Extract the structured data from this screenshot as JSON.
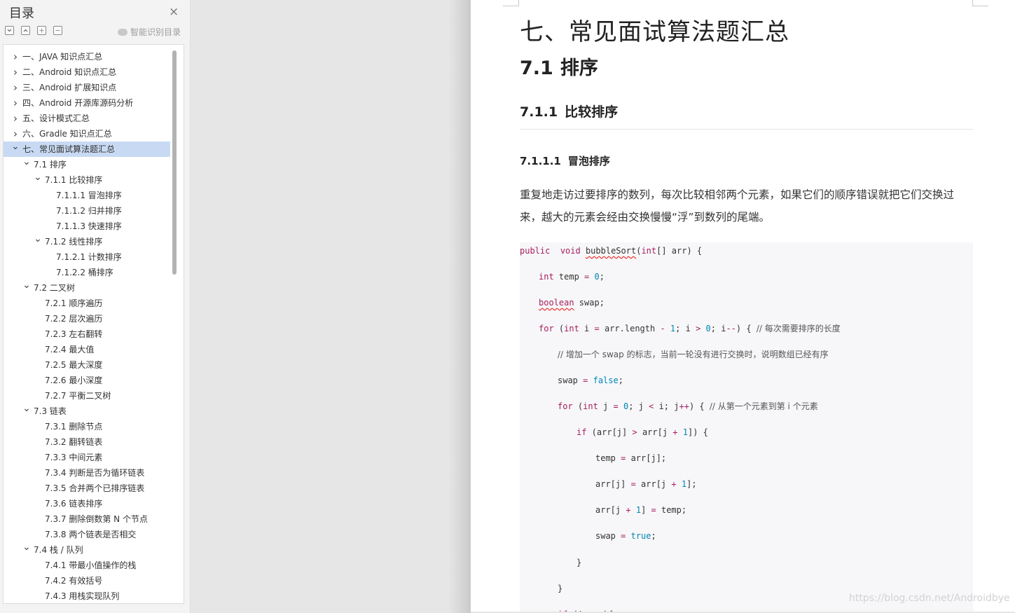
{
  "sidebar": {
    "title": "目录",
    "close_icon": "×",
    "smart_toc_label": "智能识别目录",
    "toolbar": [
      "collapse-all-icon",
      "expand-all-icon",
      "add-item-icon",
      "remove-item-icon"
    ],
    "items": [
      {
        "label": "一、JAVA 知识点汇总",
        "level": 0,
        "chevron": "right",
        "selected": false
      },
      {
        "label": "二、Android 知识点汇总",
        "level": 0,
        "chevron": "right",
        "selected": false
      },
      {
        "label": "三、Android 扩展知识点",
        "level": 0,
        "chevron": "right",
        "selected": false
      },
      {
        "label": "四、Android 开源库源码分析",
        "level": 0,
        "chevron": "right",
        "selected": false
      },
      {
        "label": "五、设计模式汇总",
        "level": 0,
        "chevron": "right",
        "selected": false
      },
      {
        "label": "六、Gradle 知识点汇总",
        "level": 0,
        "chevron": "right",
        "selected": false
      },
      {
        "label": "七、常见面试算法题汇总",
        "level": 0,
        "chevron": "down",
        "selected": true
      },
      {
        "label": "7.1  排序",
        "level": 1,
        "chevron": "down",
        "selected": false
      },
      {
        "label": "7.1.1  比较排序",
        "level": 2,
        "chevron": "down",
        "selected": false
      },
      {
        "label": "7.1.1.1  冒泡排序",
        "level": 3,
        "chevron": "",
        "selected": false
      },
      {
        "label": "7.1.1.2  归并排序",
        "level": 3,
        "chevron": "",
        "selected": false
      },
      {
        "label": "7.1.1.3  快速排序",
        "level": 3,
        "chevron": "",
        "selected": false
      },
      {
        "label": "7.1.2  线性排序",
        "level": 2,
        "chevron": "down",
        "selected": false
      },
      {
        "label": "7.1.2.1  计数排序",
        "level": 3,
        "chevron": "",
        "selected": false
      },
      {
        "label": "7.1.2.2  桶排序",
        "level": 3,
        "chevron": "",
        "selected": false
      },
      {
        "label": "7.2  二叉树",
        "level": 1,
        "chevron": "down",
        "selected": false
      },
      {
        "label": "7.2.1  顺序遍历",
        "level": 2,
        "chevron": "",
        "selected": false
      },
      {
        "label": "7.2.2  层次遍历",
        "level": 2,
        "chevron": "",
        "selected": false
      },
      {
        "label": "7.2.3  左右翻转",
        "level": 2,
        "chevron": "",
        "selected": false
      },
      {
        "label": "7.2.4  最大值",
        "level": 2,
        "chevron": "",
        "selected": false
      },
      {
        "label": "7.2.5  最大深度",
        "level": 2,
        "chevron": "",
        "selected": false
      },
      {
        "label": "7.2.6  最小深度",
        "level": 2,
        "chevron": "",
        "selected": false
      },
      {
        "label": "7.2.7  平衡二叉树",
        "level": 2,
        "chevron": "",
        "selected": false
      },
      {
        "label": "7.3  链表",
        "level": 1,
        "chevron": "down",
        "selected": false
      },
      {
        "label": "7.3.1  删除节点",
        "level": 2,
        "chevron": "",
        "selected": false
      },
      {
        "label": "7.3.2  翻转链表",
        "level": 2,
        "chevron": "",
        "selected": false
      },
      {
        "label": "7.3.3  中间元素",
        "level": 2,
        "chevron": "",
        "selected": false
      },
      {
        "label": "7.3.4  判断是否为循环链表",
        "level": 2,
        "chevron": "",
        "selected": false
      },
      {
        "label": "7.3.5  合并两个已排序链表",
        "level": 2,
        "chevron": "",
        "selected": false
      },
      {
        "label": "7.3.6  链表排序",
        "level": 2,
        "chevron": "",
        "selected": false
      },
      {
        "label": "7.3.7  删除倒数第 N 个节点",
        "level": 2,
        "chevron": "",
        "selected": false
      },
      {
        "label": "7.3.8  两个链表是否相交",
        "level": 2,
        "chevron": "",
        "selected": false
      },
      {
        "label": "7.4  栈 / 队列",
        "level": 1,
        "chevron": "down",
        "selected": false
      },
      {
        "label": "7.4.1  带最小值操作的栈",
        "level": 2,
        "chevron": "",
        "selected": false
      },
      {
        "label": "7.4.2  有效括号",
        "level": 2,
        "chevron": "",
        "selected": false
      },
      {
        "label": "7.4.3  用栈实现队列",
        "level": 2,
        "chevron": "",
        "selected": false
      }
    ]
  },
  "document": {
    "h1": "七、常见面试算法题汇总",
    "h2": {
      "num": "7.1",
      "text": "排序"
    },
    "h3": {
      "num": "7.1.1",
      "text": "比较排序"
    },
    "h4": {
      "num": "7.1.1.1",
      "text": "冒泡排序"
    },
    "paragraph": "重复地走访过要排序的数列，每次比较相邻两个元素，如果它们的顺序错误就把它们交换过来，越大的元素会经由交换慢慢“浮”到数列的尾端。",
    "code_lines": [
      {
        "indent": 0,
        "tokens": [
          [
            "kw",
            "public"
          ],
          [
            "",
            "  "
          ],
          [
            "kw",
            "void"
          ],
          [
            "",
            " "
          ],
          [
            "sq",
            "bubbleSort"
          ],
          [
            "",
            "("
          ],
          [
            "tp",
            "int"
          ],
          [
            "",
            "[] arr) {"
          ]
        ]
      },
      {
        "indent": 1,
        "tokens": [
          [
            "tp",
            "int"
          ],
          [
            "",
            " temp "
          ],
          [
            "op",
            "="
          ],
          [
            "",
            " "
          ],
          [
            "nm",
            "0"
          ],
          [
            "",
            ";"
          ]
        ]
      },
      {
        "indent": 1,
        "tokens": [
          [
            "sqk",
            "boolean"
          ],
          [
            "",
            " swap;"
          ]
        ]
      },
      {
        "indent": 1,
        "tokens": [
          [
            "kw",
            "for"
          ],
          [
            "",
            " ("
          ],
          [
            "tp",
            "int"
          ],
          [
            "",
            " i "
          ],
          [
            "op",
            "="
          ],
          [
            "",
            " arr.length "
          ],
          [
            "op",
            "-"
          ],
          [
            "",
            " "
          ],
          [
            "nm",
            "1"
          ],
          [
            "",
            "; i "
          ],
          [
            "op",
            ">"
          ],
          [
            "",
            " "
          ],
          [
            "nm",
            "0"
          ],
          [
            "",
            "; i"
          ],
          [
            "op",
            "--"
          ],
          [
            "",
            ") { "
          ],
          [
            "cm",
            "// 每次需要排序的长度"
          ]
        ]
      },
      {
        "indent": 2,
        "tokens": [
          [
            "cm",
            "// 增加一个 swap 的标志，当前一轮没有进行交换时，说明数组已经有序"
          ]
        ]
      },
      {
        "indent": 2,
        "tokens": [
          [
            "",
            ""
          ],
          [
            "",
            "swap "
          ],
          [
            "op",
            "="
          ],
          [
            "",
            " "
          ],
          [
            "nm",
            "false"
          ],
          [
            "",
            ";"
          ]
        ]
      },
      {
        "indent": 2,
        "tokens": [
          [
            "kw",
            "for"
          ],
          [
            "",
            " ("
          ],
          [
            "tp",
            "int"
          ],
          [
            "",
            " j "
          ],
          [
            "op",
            "="
          ],
          [
            "",
            " "
          ],
          [
            "nm",
            "0"
          ],
          [
            "",
            "; j "
          ],
          [
            "op",
            "<"
          ],
          [
            "",
            " i; j"
          ],
          [
            "op",
            "++"
          ],
          [
            "",
            ") { "
          ],
          [
            "cm",
            "// 从第一个元素到第 i 个元素"
          ]
        ]
      },
      {
        "indent": 3,
        "tokens": [
          [
            "kw",
            "if"
          ],
          [
            "",
            " (arr[j] "
          ],
          [
            "op",
            ">"
          ],
          [
            "",
            " arr[j "
          ],
          [
            "op",
            "+"
          ],
          [
            "",
            " "
          ],
          [
            "nm",
            "1"
          ],
          [
            "",
            "]) {"
          ]
        ]
      },
      {
        "indent": 4,
        "tokens": [
          [
            "",
            "temp "
          ],
          [
            "op",
            "="
          ],
          [
            "",
            " arr[j];"
          ]
        ]
      },
      {
        "indent": 4,
        "tokens": [
          [
            "",
            "arr[j] "
          ],
          [
            "op",
            "="
          ],
          [
            "",
            " arr[j "
          ],
          [
            "op",
            "+"
          ],
          [
            "",
            " "
          ],
          [
            "nm",
            "1"
          ],
          [
            "",
            "];"
          ]
        ]
      },
      {
        "indent": 4,
        "tokens": [
          [
            "",
            "arr[j "
          ],
          [
            "op",
            "+"
          ],
          [
            "",
            " "
          ],
          [
            "nm",
            "1"
          ],
          [
            "",
            "] "
          ],
          [
            "op",
            "="
          ],
          [
            "",
            " temp;"
          ]
        ]
      },
      {
        "indent": 4,
        "tokens": [
          [
            "",
            "swap "
          ],
          [
            "op",
            "="
          ],
          [
            "",
            " "
          ],
          [
            "nm",
            "true"
          ],
          [
            "",
            ";"
          ]
        ]
      },
      {
        "indent": 3,
        "tokens": [
          [
            "",
            "}"
          ]
        ]
      },
      {
        "indent": 2,
        "tokens": [
          [
            "",
            "}"
          ]
        ]
      },
      {
        "indent": 2,
        "tokens": [
          [
            "kw",
            "if"
          ],
          [
            "",
            " (!swap){"
          ]
        ]
      }
    ]
  },
  "watermark": "https://blog.csdn.net/Androidbye",
  "colors": {
    "selected_row": "#c8daf3",
    "keyword": "#a71d5d",
    "number": "#0086b3",
    "code_bg": "#f7f7f9"
  }
}
